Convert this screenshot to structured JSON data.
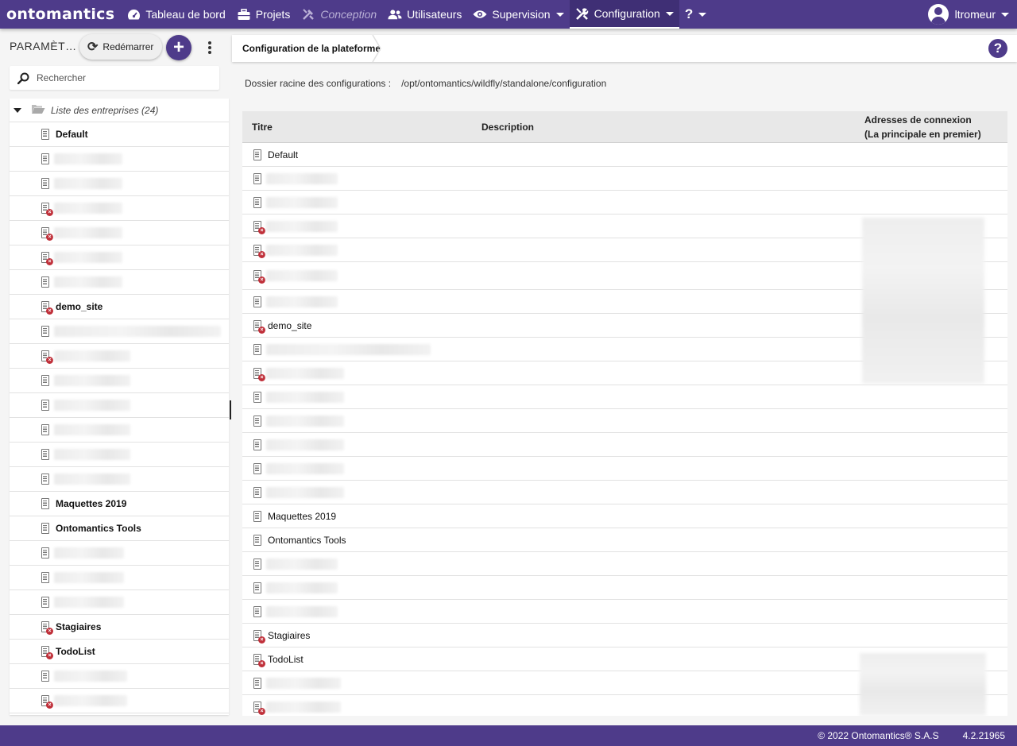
{
  "app": {
    "logo": "ontomantics",
    "nav": [
      {
        "label": "Tableau de bord",
        "icon": "gauge-icon"
      },
      {
        "label": "Projets",
        "icon": "briefcase-icon"
      },
      {
        "label": "Conception",
        "icon": "tools-icon",
        "disabled": true
      },
      {
        "label": "Utilisateurs",
        "icon": "users-icon"
      },
      {
        "label": "Supervision",
        "icon": "eye-icon",
        "dropdown": true
      },
      {
        "label": "Configuration",
        "icon": "wrench-icon",
        "dropdown": true,
        "active": true
      },
      {
        "label": "?",
        "icon": "question-icon",
        "dropdown": true
      }
    ],
    "user": "ltromeur"
  },
  "sidebar": {
    "title": "PARAMÈTRES",
    "restart_label": "Redémarrer",
    "search_placeholder": "Rechercher",
    "root_label": "Liste des entreprises (24)",
    "items": [
      {
        "label": "Default",
        "error": false
      },
      {
        "label": "",
        "error": false
      },
      {
        "label": "",
        "error": false
      },
      {
        "label": "",
        "error": true
      },
      {
        "label": "",
        "error": true
      },
      {
        "label": "",
        "error": true
      },
      {
        "label": "",
        "error": false
      },
      {
        "label": "demo_site",
        "error": true
      },
      {
        "label": "",
        "error": false
      },
      {
        "label": "",
        "error": true
      },
      {
        "label": "",
        "error": false
      },
      {
        "label": "",
        "error": false
      },
      {
        "label": "",
        "error": false
      },
      {
        "label": "",
        "error": false
      },
      {
        "label": "",
        "error": false
      },
      {
        "label": "Maquettes 2019",
        "error": false
      },
      {
        "label": "Ontomantics Tools",
        "error": false
      },
      {
        "label": "",
        "error": false
      },
      {
        "label": "",
        "error": false
      },
      {
        "label": "",
        "error": false
      },
      {
        "label": "Stagiaires",
        "error": true
      },
      {
        "label": "TodoList",
        "error": true
      },
      {
        "label": "",
        "error": false
      },
      {
        "label": "",
        "error": true
      }
    ]
  },
  "main": {
    "breadcrumb": "Configuration de la plateforme",
    "root_dir_label": "Dossier racine des configurations :",
    "root_dir_value": "/opt/ontomantics/wildfly/standalone/configuration",
    "columns": {
      "title": "Titre",
      "description": "Description",
      "addresses_line1": "Adresses de connexion",
      "addresses_line2": "(La principale en premier)"
    },
    "rows": [
      {
        "label": "Default",
        "error": false
      },
      {
        "label": "",
        "error": false
      },
      {
        "label": "",
        "error": false
      },
      {
        "label": "",
        "error": true
      },
      {
        "label": "",
        "error": true
      },
      {
        "label": "",
        "error": true
      },
      {
        "label": "",
        "error": false
      },
      {
        "label": "demo_site",
        "error": true
      },
      {
        "label": "",
        "error": false
      },
      {
        "label": "",
        "error": true
      },
      {
        "label": "",
        "error": false
      },
      {
        "label": "",
        "error": false
      },
      {
        "label": "",
        "error": false
      },
      {
        "label": "",
        "error": false
      },
      {
        "label": "",
        "error": false
      },
      {
        "label": "Maquettes 2019",
        "error": false
      },
      {
        "label": "Ontomantics Tools",
        "error": false
      },
      {
        "label": "",
        "error": false
      },
      {
        "label": "",
        "error": false
      },
      {
        "label": "",
        "error": false
      },
      {
        "label": "Stagiaires",
        "error": true
      },
      {
        "label": "TodoList",
        "error": true
      },
      {
        "label": "",
        "error": false
      },
      {
        "label": "",
        "error": true
      }
    ]
  },
  "footer": {
    "copyright": "© 2022 Ontomantics® S.A.S",
    "version": "4.2.21965"
  },
  "colors": {
    "brand": "#4e3b8a",
    "error": "#c0303a"
  }
}
